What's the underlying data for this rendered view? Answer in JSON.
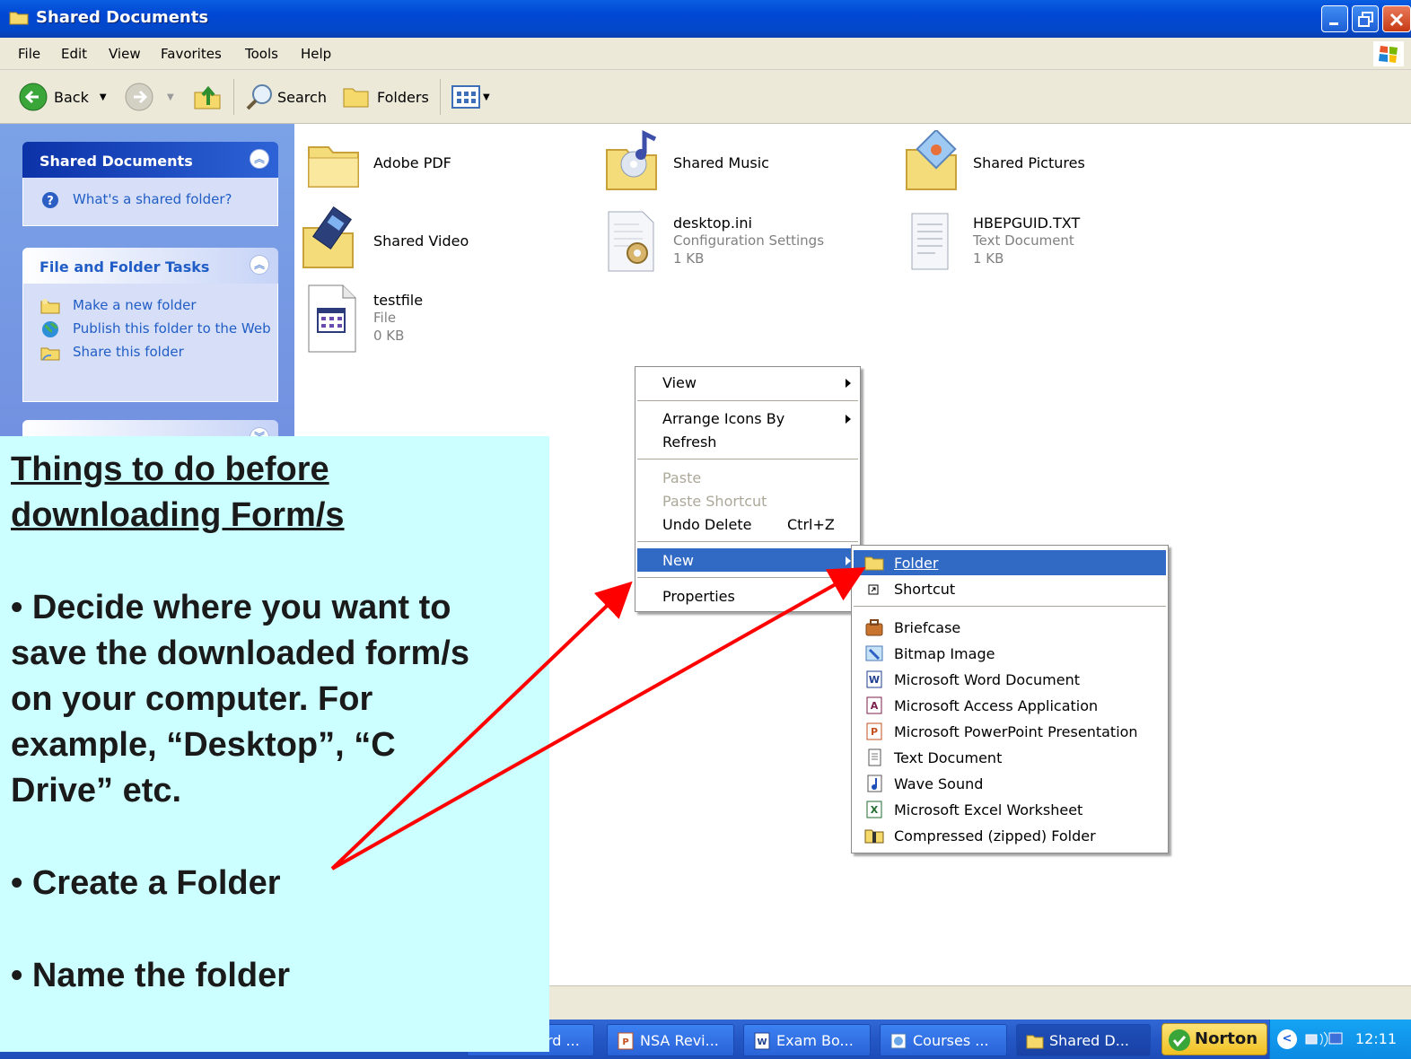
{
  "window": {
    "title": "Shared Documents"
  },
  "menubar": {
    "items": [
      "File",
      "Edit",
      "View",
      "Favorites",
      "Tools",
      "Help"
    ]
  },
  "toolbar": {
    "back": "Back",
    "search": "Search",
    "folders": "Folders"
  },
  "taskpane": {
    "shared": {
      "title": "Shared Documents",
      "link": "What's a shared folder?"
    },
    "tasks": {
      "title": "File and Folder Tasks",
      "links": [
        "Make a new folder",
        "Publish this folder to the Web",
        "Share this folder"
      ]
    }
  },
  "files": [
    {
      "name": "Adobe PDF"
    },
    {
      "name": "Shared Music"
    },
    {
      "name": "Shared Pictures"
    },
    {
      "name": "Shared Video"
    },
    {
      "name": "desktop.ini",
      "type": "Configuration Settings",
      "size": "1 KB"
    },
    {
      "name": "HBEPGUID.TXT",
      "type": "Text Document",
      "size": "1 KB"
    },
    {
      "name": "testfile",
      "type": "File",
      "size": "0 KB"
    }
  ],
  "context_menu": {
    "view": "View",
    "arrange": "Arrange Icons By",
    "refresh": "Refresh",
    "paste": "Paste",
    "paste_shortcut": "Paste Shortcut",
    "undo": "Undo Delete",
    "undo_key": "Ctrl+Z",
    "new": "New",
    "properties": "Properties"
  },
  "new_submenu": {
    "folder": "Folder",
    "shortcut": "Shortcut",
    "items": [
      "Briefcase",
      "Bitmap Image",
      "Microsoft Word Document",
      "Microsoft Access Application",
      "Microsoft PowerPoint Presentation",
      "Text Document",
      "Wave Sound",
      "Microsoft Excel Worksheet",
      "Compressed (zipped) Folder"
    ]
  },
  "note": {
    "heading_1": "Things to do before",
    "heading_2": "downloading Form/s",
    "b1_1": "• Decide where you want to",
    "b1_2": "save the downloaded form/s",
    "b1_3": "on your computer.  For",
    "b1_4": "example, “Desktop”, “C",
    "b1_5": "Drive” etc.",
    "b2": "• Create a Folder",
    "b3": "• Name the folder"
  },
  "taskbar": {
    "tasks": [
      "rd ...",
      "NSA Revi...",
      "Exam Bo...",
      "Courses ...",
      "Shared D..."
    ],
    "norton": "Norton",
    "clock": "12:11"
  },
  "colors": {
    "selection": "#316ac5",
    "note_bg": "#ccffff",
    "arrow": "#ff0000"
  }
}
